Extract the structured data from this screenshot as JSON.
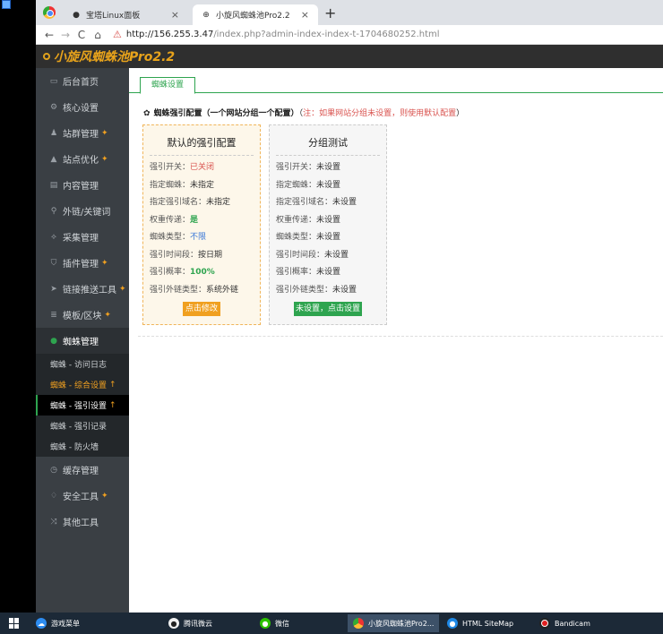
{
  "browser": {
    "tabs": [
      {
        "title": "宝塔Linux面板",
        "close": "×"
      },
      {
        "title": "小旋风蜘蛛池Pro2.2",
        "close": "×"
      }
    ],
    "new_tab": "+",
    "url_host": "http://156.255.3.47",
    "url_path": "/index.php?admin-index-index-t-1704680252.html"
  },
  "app": {
    "title": "小旋风蜘蛛池Pro2.2"
  },
  "sidebar": {
    "items": [
      {
        "label": "后台首页"
      },
      {
        "label": "核心设置"
      },
      {
        "label": "站群管理"
      },
      {
        "label": "站点优化"
      },
      {
        "label": "内容管理"
      },
      {
        "label": "外链/关键词"
      },
      {
        "label": "采集管理"
      },
      {
        "label": "插件管理"
      },
      {
        "label": "链接推送工具"
      },
      {
        "label": "模板/区块"
      },
      {
        "label": "蜘蛛管理"
      }
    ],
    "subitems": [
      {
        "label": "蜘蛛 - 访问日志"
      },
      {
        "label": "蜘蛛 - 综合设置"
      },
      {
        "label": "蜘蛛 - 强引设置"
      },
      {
        "label": "蜘蛛 - 强引记录"
      },
      {
        "label": "蜘蛛 - 防火墙"
      }
    ],
    "bottom": [
      {
        "label": "缓存管理"
      },
      {
        "label": "安全工具"
      },
      {
        "label": "其他工具"
      }
    ]
  },
  "main": {
    "tab": "蜘蛛设置",
    "config_title": "蜘蛛强引配置（一个网站分组一个配置）",
    "config_note_open": "（",
    "config_note": "注：如果网站分组未设置，则使用默认配置",
    "config_note_close": "）",
    "cards": [
      {
        "title": "默认的强引配置",
        "rows": [
          {
            "label": "强引开关：",
            "value": "已关闭"
          },
          {
            "label": "指定蜘蛛：",
            "value": "未指定"
          },
          {
            "label": "指定强引域名：",
            "value": "未指定"
          },
          {
            "label": "权重传递：",
            "value": "是"
          },
          {
            "label": "蜘蛛类型：",
            "value": "不限"
          },
          {
            "label": "强引时间段：",
            "value": "按日期"
          },
          {
            "label": "强引概率：",
            "value": "100%"
          },
          {
            "label": "强引外链类型：",
            "value": "系统外链"
          }
        ],
        "button": "点击修改"
      },
      {
        "title": "分组测试",
        "rows": [
          {
            "label": "强引开关：",
            "value": "未设置"
          },
          {
            "label": "指定蜘蛛：",
            "value": "未设置"
          },
          {
            "label": "指定强引域名：",
            "value": "未设置"
          },
          {
            "label": "权重传递：",
            "value": "未设置"
          },
          {
            "label": "蜘蛛类型：",
            "value": "未设置"
          },
          {
            "label": "强引时间段：",
            "value": "未设置"
          },
          {
            "label": "强引概率：",
            "value": "未设置"
          },
          {
            "label": "强引外链类型：",
            "value": "未设置"
          }
        ],
        "button": "未设置，点击设置"
      }
    ]
  },
  "taskbar": {
    "items": [
      {
        "label": "游戏菜单"
      },
      {
        "label": "腾讯微云"
      },
      {
        "label": "微信"
      },
      {
        "label": "小旋风蜘蛛池Pro2..."
      },
      {
        "label": "HTML SiteMap"
      },
      {
        "label": "Bandicam"
      }
    ]
  },
  "colors": {
    "accent_green": "#2ea44f",
    "accent_orange": "#f0a020",
    "header_bg": "#2f2f2f",
    "sidebar_bg": "#3a3f44"
  }
}
